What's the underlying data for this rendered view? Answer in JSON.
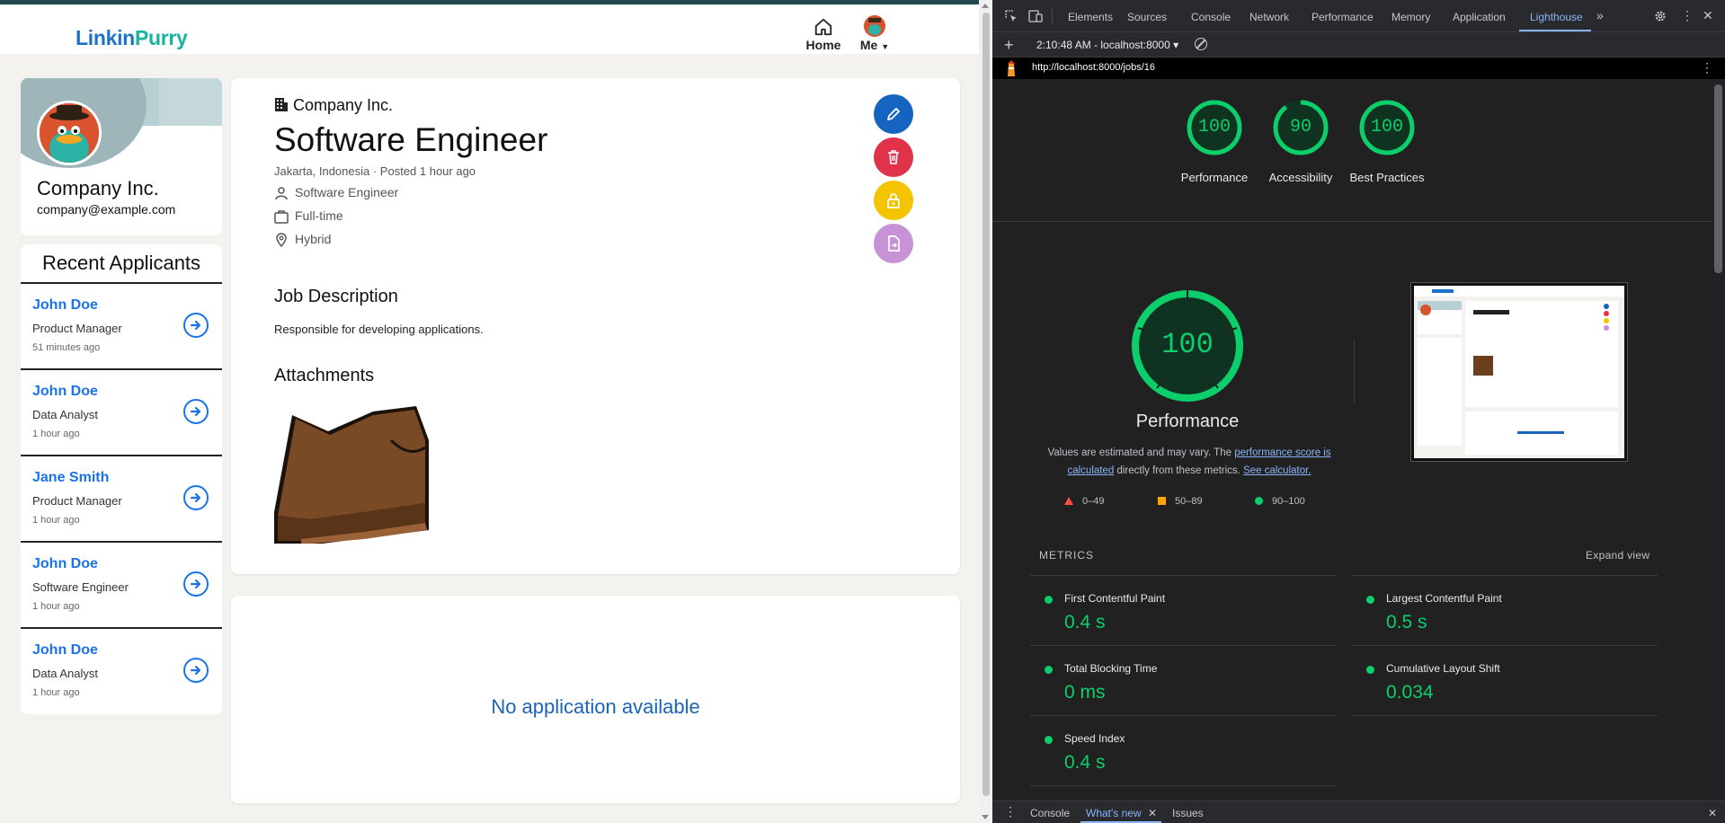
{
  "app": {
    "logo": {
      "part1": "Link",
      "part2": "in",
      "part3": "Purry"
    },
    "nav": {
      "home": "Home",
      "me": "Me"
    },
    "profile": {
      "name": "Company Inc.",
      "email": "company@example.com"
    },
    "applicants": {
      "title": "Recent Applicants",
      "items": [
        {
          "name": "John Doe",
          "role": "Product Manager",
          "time": "51 minutes ago"
        },
        {
          "name": "John Doe",
          "role": "Data Analyst",
          "time": "1 hour ago"
        },
        {
          "name": "Jane Smith",
          "role": "Product Manager",
          "time": "1 hour ago"
        },
        {
          "name": "John Doe",
          "role": "Software Engineer",
          "time": "1 hour ago"
        },
        {
          "name": "John Doe",
          "role": "Data Analyst",
          "time": "1 hour ago"
        }
      ]
    },
    "job": {
      "company": "Company Inc.",
      "title": "Software Engineer",
      "meta": "Jakarta, Indonesia · Posted 1 hour ago",
      "position": "Software Engineer",
      "type": "Full-time",
      "location_type": "Hybrid",
      "description_heading": "Job Description",
      "description": "Responsible for developing applications.",
      "attachments_heading": "Attachments"
    },
    "applications": {
      "empty_text": "No application available"
    },
    "colors": {
      "edit": "#1565c0",
      "delete": "#e0334a",
      "close": "#f5c400",
      "export": "#c892d6",
      "link": "#1a73e8"
    }
  },
  "devtools": {
    "tabs": [
      "Elements",
      "Sources",
      "Console",
      "Network",
      "Performance",
      "Memory",
      "Application",
      "Lighthouse"
    ],
    "session": "2:10:48 AM - localhost:8000 ▾",
    "url": "http://localhost:8000/jobs/16",
    "scores": [
      {
        "label": "Performance",
        "value": "100",
        "fraction": 1.0
      },
      {
        "label": "Accessibility",
        "value": "90",
        "fraction": 0.9
      },
      {
        "label": "Best Practices",
        "value": "100",
        "fraction": 1.0
      }
    ],
    "performance": {
      "score": "100",
      "title": "Performance",
      "note_1": "Values are estimated and may vary. The ",
      "note_link_1": "performance score is calculated",
      "note_2": " directly from these metrics. ",
      "note_link_2": "See calculator."
    },
    "legend": [
      {
        "range": "0–49",
        "color": "#ff4e42"
      },
      {
        "range": "50–89",
        "color": "#ffa400"
      },
      {
        "range": "90–100",
        "color": "#0cce6b"
      }
    ],
    "metrics_heading": "METRICS",
    "expand_view": "Expand view",
    "metrics": [
      {
        "name": "First Contentful Paint",
        "value": "0.4 s"
      },
      {
        "name": "Largest Contentful Paint",
        "value": "0.5 s"
      },
      {
        "name": "Total Blocking Time",
        "value": "0 ms"
      },
      {
        "name": "Cumulative Layout Shift",
        "value": "0.034"
      },
      {
        "name": "Speed Index",
        "value": "0.4 s"
      }
    ],
    "drawer_tabs": [
      "Console",
      "What's new",
      "Issues"
    ]
  }
}
